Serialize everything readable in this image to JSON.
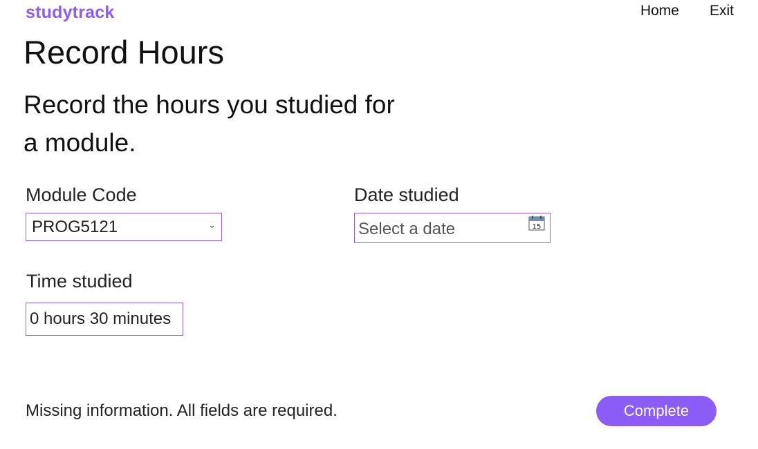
{
  "app": {
    "logo": "studytrack",
    "brand_color": "#8b5cf6"
  },
  "nav": {
    "home_label": "Home",
    "exit_label": "Exit"
  },
  "page": {
    "title": "Record Hours",
    "subtitle": "Record the hours you studied for a module."
  },
  "form": {
    "module_code": {
      "label": "Module Code",
      "selected_value": "PROG5121",
      "icon": "chevron-down-icon"
    },
    "date_studied": {
      "label": "Date studied",
      "placeholder": "Select a date",
      "icon": "calendar-icon",
      "calendar_day": "15"
    },
    "time_studied": {
      "label": "Time studied",
      "value": "0 hours 30 minutes"
    }
  },
  "footer": {
    "status_message": "Missing information. All fields are required.",
    "complete_label": "Complete"
  }
}
